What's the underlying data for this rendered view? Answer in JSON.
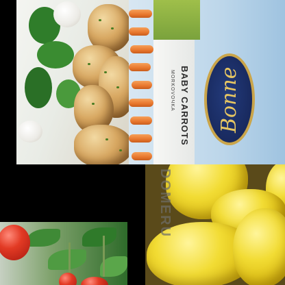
{
  "tiles": {
    "potatoes": {
      "subject": "roasted potatoes with dill"
    },
    "carrots": {
      "brand_logo": "Bonne",
      "product_title": "BABY CARROTS",
      "product_sub": "MORKOVOЧKA"
    },
    "squash": {
      "stamp": "DOMERU"
    },
    "tomatoes": {
      "subject": "cherry tomatoes on vine"
    }
  }
}
